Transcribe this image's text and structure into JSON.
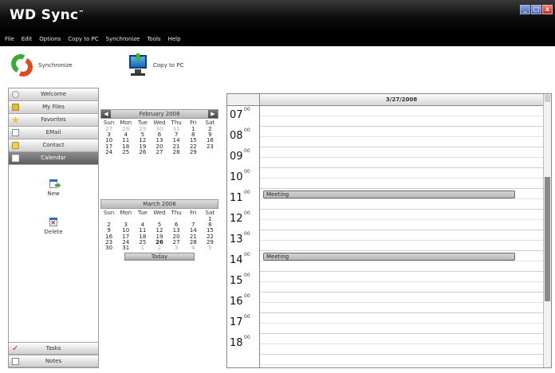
{
  "app": {
    "title": "WD Sync",
    "trademark": "™"
  },
  "window_buttons": {
    "minimize": "_",
    "maximize": "□",
    "close": "x"
  },
  "menu": [
    "File",
    "Edit",
    "Options",
    "Copy to PC",
    "Synchronize",
    "Tools",
    "Help"
  ],
  "toolbar": {
    "sync_label": "Synchronize",
    "copy_label": "Copy to PC"
  },
  "sidebar": {
    "items": [
      {
        "label": "Welcome",
        "icon": "globe-icon"
      },
      {
        "label": "My Files",
        "icon": "folder-icon"
      },
      {
        "label": "Favorites",
        "icon": "star-icon"
      },
      {
        "label": "EMail",
        "icon": "mail-icon"
      },
      {
        "label": "Contact",
        "icon": "contact-icon"
      },
      {
        "label": "Calendar",
        "icon": "calendar-icon",
        "active": true
      }
    ],
    "actions": [
      {
        "label": "New",
        "icon": "new-appointment-icon"
      },
      {
        "label": "Delete",
        "icon": "delete-appointment-icon"
      }
    ],
    "bottom": [
      {
        "label": "Tasks",
        "icon": "tasks-icon"
      },
      {
        "label": "Notes",
        "icon": "notes-icon"
      }
    ]
  },
  "calendars": {
    "dow": [
      "Sun",
      "Mon",
      "Tue",
      "Wed",
      "Thu",
      "Fri",
      "Sat"
    ],
    "feb": {
      "title": "February 2008",
      "prev": "◀",
      "next": "▶",
      "weeks": [
        [
          "27",
          "28",
          "29",
          "30",
          "31",
          "1",
          "2"
        ],
        [
          "3",
          "4",
          "5",
          "6",
          "7",
          "8",
          "9"
        ],
        [
          "10",
          "11",
          "12",
          "13",
          "14",
          "15",
          "16"
        ],
        [
          "17",
          "18",
          "19",
          "20",
          "21",
          "22",
          "23"
        ],
        [
          "24",
          "25",
          "26",
          "27",
          "28",
          "29",
          ""
        ]
      ]
    },
    "mar": {
      "title": "March 2008",
      "weeks": [
        [
          "",
          "",
          "",
          "",
          "",
          "",
          "1"
        ],
        [
          "2",
          "3",
          "4",
          "5",
          "6",
          "7",
          "8"
        ],
        [
          "9",
          "10",
          "11",
          "12",
          "13",
          "14",
          "15"
        ],
        [
          "16",
          "17",
          "18",
          "19",
          "20",
          "21",
          "22"
        ],
        [
          "23",
          "24",
          "25",
          "26",
          "27",
          "28",
          "29"
        ],
        [
          "30",
          "31",
          "1",
          "2",
          "3",
          "4",
          "5"
        ]
      ],
      "selected": "27"
    },
    "today_label": "Today"
  },
  "dayview": {
    "date": "3/27/2008",
    "hours": [
      "07",
      "08",
      "09",
      "10",
      "11",
      "12",
      "13",
      "14",
      "15",
      "16",
      "17",
      "18"
    ],
    "minutes": "00",
    "events": [
      {
        "title": "Meeting",
        "hour": "11"
      },
      {
        "title": "Meeting",
        "hour": "14"
      }
    ]
  }
}
